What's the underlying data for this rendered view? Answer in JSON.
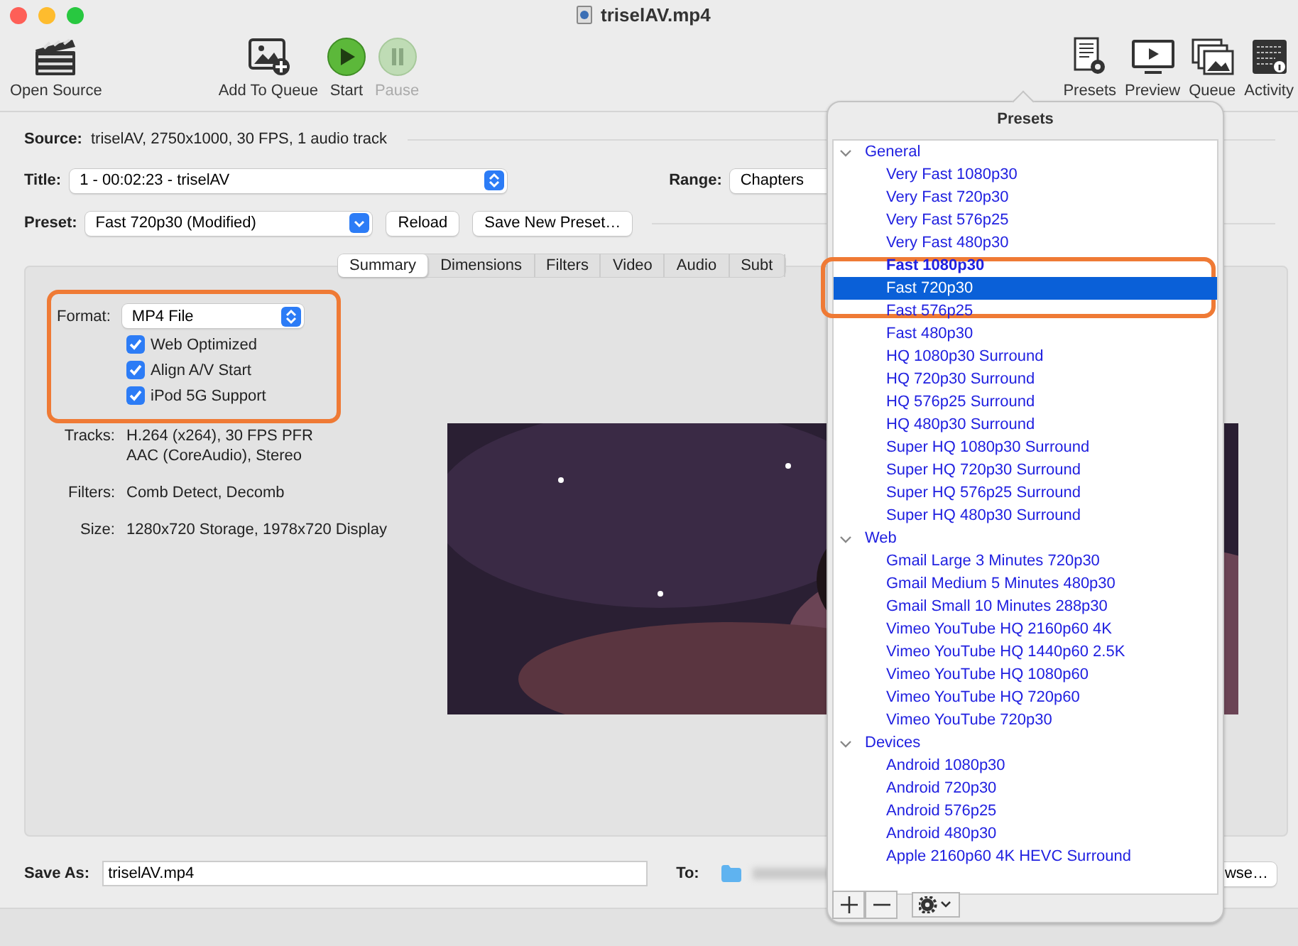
{
  "window": {
    "title": "triselAV.mp4"
  },
  "toolbar": {
    "left": [
      {
        "label": "Open Source",
        "kind": "clapper",
        "disabled": false
      },
      {
        "label": "Add To Queue",
        "kind": "add-queue",
        "disabled": false
      },
      {
        "label": "Start",
        "kind": "play",
        "disabled": false
      },
      {
        "label": "Pause",
        "kind": "pause",
        "disabled": true
      }
    ],
    "right": [
      {
        "label": "Presets",
        "kind": "presets",
        "disabled": false
      },
      {
        "label": "Preview",
        "kind": "preview",
        "disabled": false
      },
      {
        "label": "Queue",
        "kind": "queue",
        "disabled": false
      },
      {
        "label": "Activity",
        "kind": "activity",
        "disabled": false
      }
    ]
  },
  "source": {
    "label": "Source:",
    "value": "triselAV, 2750x1000, 30 FPS, 1 audio track"
  },
  "title_row": {
    "label": "Title:",
    "value": "1 - 00:02:23 - triselAV",
    "range_label": "Range:",
    "range_value": "Chapters"
  },
  "preset_row": {
    "label": "Preset:",
    "value": "Fast 720p30 (Modified)",
    "buttons": [
      "Reload",
      "Save New Preset…"
    ]
  },
  "tabs": [
    {
      "label": "Summary",
      "selected": true
    },
    {
      "label": "Dimensions",
      "selected": false
    },
    {
      "label": "Filters",
      "selected": false
    },
    {
      "label": "Video",
      "selected": false
    },
    {
      "label": "Audio",
      "selected": false
    },
    {
      "label": "Subt",
      "selected": false
    }
  ],
  "format": {
    "label": "Format:",
    "value": "MP4 File",
    "options": [
      {
        "label": "Web Optimized",
        "checked": true
      },
      {
        "label": "Align A/V Start",
        "checked": true
      },
      {
        "label": "iPod 5G Support",
        "checked": true
      }
    ]
  },
  "summary": [
    {
      "label": "Tracks:",
      "lines": [
        "H.264 (x264), 30 FPS PFR",
        "AAC (CoreAudio), Stereo"
      ]
    },
    {
      "label": "Filters:",
      "lines": [
        "Comb Detect, Decomb"
      ]
    },
    {
      "label": "Size:",
      "lines": [
        "1280x720 Storage, 1978x720 Display"
      ]
    }
  ],
  "save_row": {
    "label": "Save As:",
    "value": "triselAV.mp4",
    "to_label": "To:",
    "browse": "wse…"
  },
  "presets_popover": {
    "title": "Presets",
    "groups": [
      {
        "name": "General",
        "expanded": true,
        "children": [
          {
            "label": "Very Fast 1080p30",
            "default": false,
            "selected": false
          },
          {
            "label": "Very Fast 720p30",
            "default": false,
            "selected": false
          },
          {
            "label": "Very Fast 576p25",
            "default": false,
            "selected": false
          },
          {
            "label": "Very Fast 480p30",
            "default": false,
            "selected": false
          },
          {
            "label": "Fast 1080p30",
            "default": true,
            "selected": false
          },
          {
            "label": "Fast 720p30",
            "default": false,
            "selected": true
          },
          {
            "label": "Fast 576p25",
            "default": false,
            "selected": false
          },
          {
            "label": "Fast 480p30",
            "default": false,
            "selected": false
          },
          {
            "label": "HQ 1080p30 Surround",
            "default": false,
            "selected": false
          },
          {
            "label": "HQ 720p30 Surround",
            "default": false,
            "selected": false
          },
          {
            "label": "HQ 576p25 Surround",
            "default": false,
            "selected": false
          },
          {
            "label": "HQ 480p30 Surround",
            "default": false,
            "selected": false
          },
          {
            "label": "Super HQ 1080p30 Surround",
            "default": false,
            "selected": false
          },
          {
            "label": "Super HQ 720p30 Surround",
            "default": false,
            "selected": false
          },
          {
            "label": "Super HQ 576p25 Surround",
            "default": false,
            "selected": false
          },
          {
            "label": "Super HQ 480p30 Surround",
            "default": false,
            "selected": false
          }
        ]
      },
      {
        "name": "Web",
        "expanded": true,
        "children": [
          {
            "label": "Gmail Large 3 Minutes 720p30",
            "default": false,
            "selected": false
          },
          {
            "label": "Gmail Medium 5 Minutes 480p30",
            "default": false,
            "selected": false
          },
          {
            "label": "Gmail Small 10 Minutes 288p30",
            "default": false,
            "selected": false
          },
          {
            "label": "Vimeo YouTube HQ 2160p60 4K",
            "default": false,
            "selected": false
          },
          {
            "label": "Vimeo YouTube HQ 1440p60 2.5K",
            "default": false,
            "selected": false
          },
          {
            "label": "Vimeo YouTube HQ 1080p60",
            "default": false,
            "selected": false
          },
          {
            "label": "Vimeo YouTube HQ 720p60",
            "default": false,
            "selected": false
          },
          {
            "label": "Vimeo YouTube 720p30",
            "default": false,
            "selected": false
          }
        ]
      },
      {
        "name": "Devices",
        "expanded": true,
        "children": [
          {
            "label": "Android 1080p30",
            "default": false,
            "selected": false
          },
          {
            "label": "Android 720p30",
            "default": false,
            "selected": false
          },
          {
            "label": "Android 576p25",
            "default": false,
            "selected": false
          },
          {
            "label": "Android 480p30",
            "default": false,
            "selected": false
          },
          {
            "label": "Apple 2160p60 4K HEVC Surround",
            "default": false,
            "selected": false
          }
        ]
      }
    ]
  }
}
